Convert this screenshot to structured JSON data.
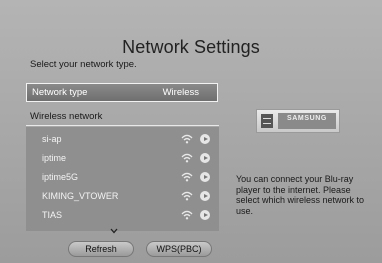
{
  "page": {
    "title": "Network Settings",
    "subtitle": "Select your network type."
  },
  "network_type": {
    "label": "Network type",
    "value": "Wireless"
  },
  "wireless_section": {
    "label": "Wireless network"
  },
  "networks": [
    {
      "name": "si-ap",
      "icon": "wifi-icon"
    },
    {
      "name": "iptime",
      "icon": "wifi-icon"
    },
    {
      "name": "iptime5G",
      "icon": "wifi-icon"
    },
    {
      "name": "KIMING_VTOWER",
      "icon": "wifi-icon"
    },
    {
      "name": "TIAS",
      "icon": "wifi-icon"
    }
  ],
  "buttons": {
    "refresh": "Refresh",
    "wps": "WPS(PBC)"
  },
  "device": {
    "brand": "SAMSUNG"
  },
  "info_text": "You can connect your Blu-ray player to the internet. Please select which wireless network to use.",
  "colors": {
    "background": "#aaaaaa",
    "selected_row": "#7a7a7a",
    "list_bg": "#8f8f8f",
    "accent_border": "#f2f2f2"
  }
}
